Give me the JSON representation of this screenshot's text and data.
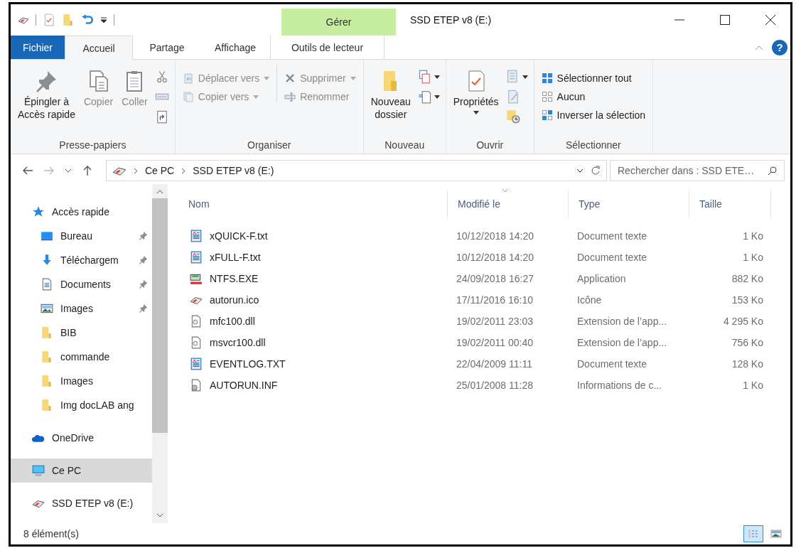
{
  "title_bar": {
    "contextual_tab": "Gérer",
    "title": "SSD ETEP v8 (E:)"
  },
  "ribbon": {
    "tabs": [
      {
        "label": "Fichier",
        "kind": "file",
        "selected": false
      },
      {
        "label": "Accueil",
        "kind": "normal",
        "selected": true
      },
      {
        "label": "Partage",
        "kind": "normal",
        "selected": false
      },
      {
        "label": "Affichage",
        "kind": "normal",
        "selected": false
      },
      {
        "label": "Outils de lecteur",
        "kind": "contextual",
        "selected": false
      }
    ],
    "help": "?",
    "groups": [
      {
        "label": "Presse-papiers",
        "columns": [
          {
            "kind": "large",
            "label": "Épingler à\nAccès rapide",
            "disabled": false,
            "dropdown": false
          },
          {
            "kind": "large",
            "label": "Copier",
            "disabled": true,
            "dropdown": false
          },
          {
            "kind": "large",
            "label": "Coller",
            "disabled": true,
            "dropdown": false
          },
          {
            "kind": "icons"
          }
        ]
      },
      {
        "label": "Organiser",
        "columns": [
          {
            "kind": "small",
            "items": [
              {
                "label": "Déplacer vers",
                "disabled": true,
                "dropdown": true
              },
              {
                "label": "Copier vers",
                "disabled": true,
                "dropdown": true
              }
            ]
          },
          {
            "kind": "small",
            "items": [
              {
                "label": "Supprimer",
                "disabled": true,
                "dropdown": true
              },
              {
                "label": "Renommer",
                "disabled": true,
                "dropdown": false
              }
            ]
          }
        ]
      },
      {
        "label": "Nouveau",
        "columns": [
          {
            "kind": "large",
            "label": "Nouveau\ndossier",
            "disabled": false,
            "dropdown": false
          },
          {
            "kind": "icons"
          }
        ]
      },
      {
        "label": "Ouvrir",
        "columns": [
          {
            "kind": "large",
            "label": "Propriétés",
            "disabled": false,
            "dropdown": true
          },
          {
            "kind": "icons"
          }
        ]
      },
      {
        "label": "Sélectionner",
        "columns": [
          {
            "kind": "small",
            "items": [
              {
                "label": "Sélectionner tout",
                "disabled": false,
                "dropdown": false
              },
              {
                "label": "Aucun",
                "disabled": false,
                "dropdown": false
              },
              {
                "label": "Inverser la sélection",
                "disabled": false,
                "dropdown": false
              }
            ]
          }
        ]
      }
    ]
  },
  "address": {
    "breadcrumbs": [
      "Ce PC",
      "SSD ETEP v8 (E:)"
    ],
    "search_placeholder": "Rechercher dans : SSD ETE…"
  },
  "nav_pane": [
    {
      "label": "Accès rapide",
      "kind": "quick_access",
      "selected": false,
      "children": [
        {
          "label": "Bureau",
          "kind": "desktop",
          "pinned": true,
          "selected": false
        },
        {
          "label": "Téléchargem",
          "kind": "downloads",
          "pinned": true,
          "selected": false
        },
        {
          "label": "Documents",
          "kind": "documents",
          "pinned": true,
          "selected": false
        },
        {
          "label": "Images",
          "kind": "pictures",
          "pinned": true,
          "selected": false
        },
        {
          "label": "BIB",
          "kind": "folder",
          "pinned": false,
          "selected": false
        },
        {
          "label": "commande",
          "kind": "folder",
          "pinned": false,
          "selected": false
        },
        {
          "label": "Images",
          "kind": "folder",
          "pinned": false,
          "selected": false
        },
        {
          "label": "Img docLAB ang",
          "kind": "folder",
          "pinned": false,
          "selected": false
        }
      ]
    },
    {
      "label": "OneDrive",
      "kind": "onedrive",
      "selected": false
    },
    {
      "label": "Ce PC",
      "kind": "pc",
      "selected": true
    },
    {
      "label": "SSD ETEP v8 (E:)",
      "kind": "drive",
      "selected": false
    }
  ],
  "files": {
    "columns": [
      {
        "label": "Nom",
        "sorted": false
      },
      {
        "label": "Modifié le",
        "sorted": true
      },
      {
        "label": "Type",
        "sorted": false
      },
      {
        "label": "Taille",
        "sorted": false
      }
    ],
    "rows": [
      {
        "kind": "text",
        "name": "xQUICK-F.txt",
        "modified": "10/12/2018 14:20",
        "type": "Document texte",
        "size": "1 Ko"
      },
      {
        "kind": "text",
        "name": "xFULL-F.txt",
        "modified": "10/12/2018 14:20",
        "type": "Document texte",
        "size": "1 Ko"
      },
      {
        "kind": "application",
        "name": "NTFS.EXE",
        "modified": "24/09/2018 16:27",
        "type": "Application",
        "size": "882 Ko"
      },
      {
        "kind": "icon",
        "name": "autorun.ico",
        "modified": "17/11/2016 16:10",
        "type": "Icône",
        "size": "153 Ko"
      },
      {
        "kind": "library",
        "name": "mfc100.dll",
        "modified": "19/02/2011 23:03",
        "type": "Extension de l’app...",
        "size": "4 295 Ko"
      },
      {
        "kind": "library",
        "name": "msvcr100.dll",
        "modified": "19/02/2011 00:40",
        "type": "Extension de l’app...",
        "size": "756 Ko"
      },
      {
        "kind": "text",
        "name": "EVENTLOG.TXT",
        "modified": "22/04/2009 11:11",
        "type": "Document texte",
        "size": "128 Ko"
      },
      {
        "kind": "setup_info",
        "name": "AUTORUN.INF",
        "modified": "25/01/2008 11:28",
        "type": "Informations de c...",
        "size": "1 Ko"
      }
    ]
  },
  "status_bar": {
    "count": "8 élément(s)",
    "views": [
      {
        "kind": "details",
        "selected": true
      },
      {
        "kind": "large_icons",
        "selected": false
      }
    ]
  }
}
